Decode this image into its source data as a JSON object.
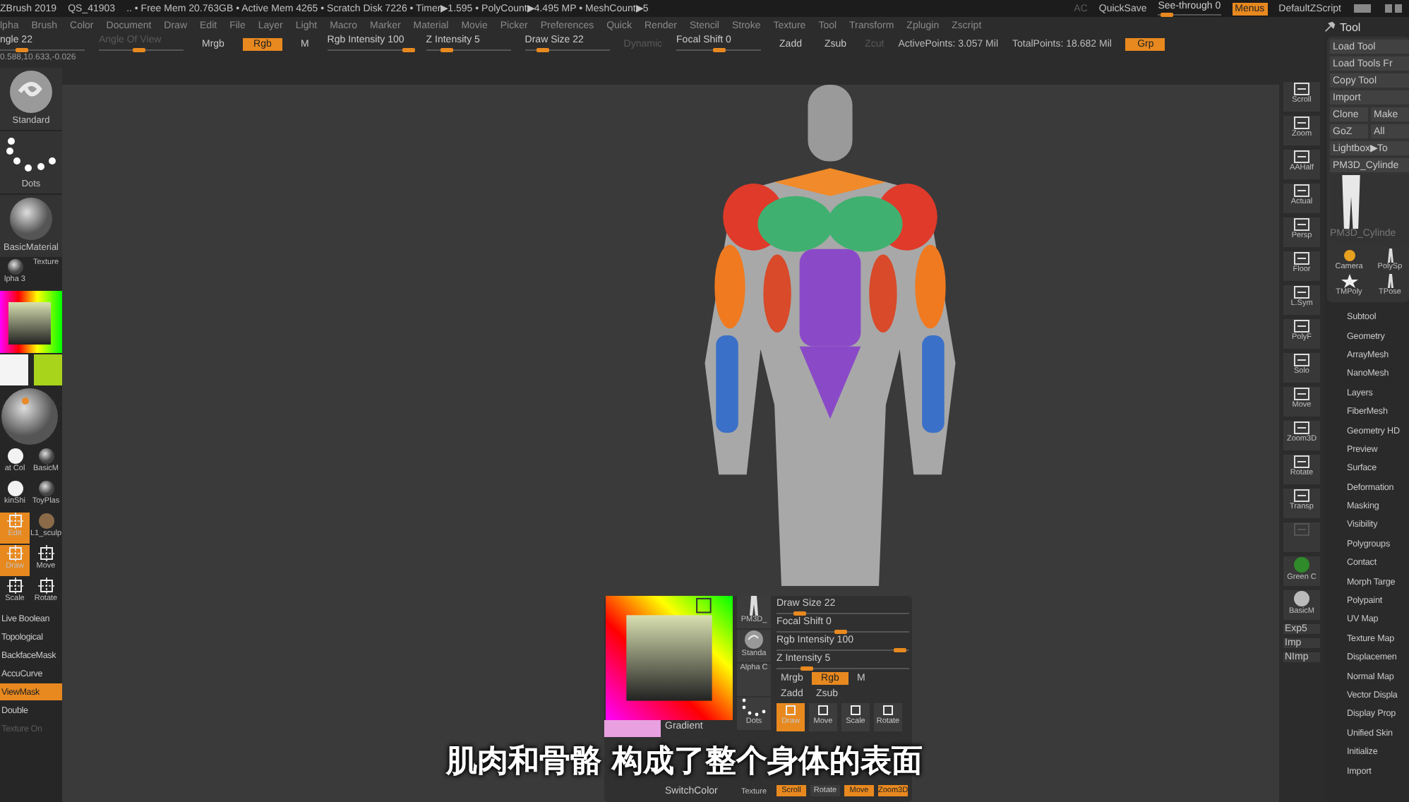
{
  "title_bar": {
    "app": "ZBrush 2019",
    "file": "QS_41903",
    "status": ".. • Free Mem 20.763GB • Active Mem 4265 • Scratch Disk 7226 • Timer▶1.595 • PolyCount▶4.495 MP • MeshCount▶5",
    "controls": [
      {
        "kind": "text",
        "label": "AC",
        "disabled": true
      },
      {
        "kind": "text",
        "label": "QuickSave",
        "disabled": false
      },
      {
        "kind": "slider",
        "label": "See-through 0",
        "level": 0.05
      },
      {
        "kind": "button",
        "label": "Menus",
        "selected": true
      },
      {
        "kind": "text",
        "label": "DefaultZScript",
        "disabled": false
      }
    ]
  },
  "menu": [
    "lpha",
    "Brush",
    "Color",
    "Document",
    "Draw",
    "Edit",
    "File",
    "Layer",
    "Light",
    "Macro",
    "Marker",
    "Material",
    "Movie",
    "Picker",
    "Preferences",
    "Quick",
    "Render",
    "Stencil",
    "Stroke",
    "Texture",
    "Tool",
    "Transform",
    "Zplugin",
    "Zscript"
  ],
  "top_shelf": [
    {
      "kind": "slider",
      "label": "ngle 22",
      "level": 0.2,
      "disabled": false
    },
    {
      "kind": "slider",
      "label": "Angle Of View",
      "level": 0.45,
      "disabled": true
    },
    {
      "kind": "toggle",
      "label": "Mrgb",
      "selected": false
    },
    {
      "kind": "toggle",
      "label": "Rgb",
      "selected": true
    },
    {
      "kind": "toggle",
      "label": "M",
      "selected": false
    },
    {
      "kind": "slider",
      "label": "Rgb Intensity 100",
      "level": 1,
      "disabled": false
    },
    {
      "kind": "slider",
      "label": "Z Intensity 5",
      "level": 0.2,
      "disabled": false
    },
    {
      "kind": "slider",
      "label": "Draw Size 22",
      "level": 0.15,
      "disabled": false
    },
    {
      "kind": "text",
      "label": "Dynamic",
      "disabled": true
    },
    {
      "kind": "slider",
      "label": "Focal Shift 0",
      "level": 0.5,
      "disabled": false
    },
    {
      "kind": "toggle",
      "label": "Zadd",
      "selected": false
    },
    {
      "kind": "toggle",
      "label": "Zsub",
      "selected": false
    },
    {
      "kind": "text",
      "label": "Zcut",
      "disabled": true
    },
    {
      "kind": "text",
      "label": "ActivePoints: 3.057 Mil",
      "disabled": false
    },
    {
      "kind": "text",
      "label": "TotalPoints: 18.682 Mil",
      "disabled": false
    },
    {
      "kind": "toggle",
      "label": "Grp",
      "selected": true
    }
  ],
  "coordinates": "0.588,10.633,-0.026",
  "left_shelf": [
    {
      "kind": "swirl",
      "label": "Standard"
    },
    {
      "kind": "dots",
      "label": "Dots"
    },
    {
      "kind": "sphere",
      "label": "BasicMaterial"
    },
    {
      "kind": "pair",
      "items": [
        {
          "kind": "sphere",
          "label": "lpha 3",
          "selected": false
        },
        {
          "kind": "blank",
          "label": "Texture",
          "selected": false
        }
      ]
    },
    {
      "kind": "picker"
    },
    {
      "kind": "swatches",
      "items": [
        {
          "color": "#f4f4f4"
        },
        {
          "color": "#a8d41c"
        }
      ]
    },
    {
      "kind": "preview"
    },
    {
      "kind": "pair",
      "items": [
        {
          "kind": "white",
          "label": "at Col",
          "selected": false
        },
        {
          "kind": "sphere",
          "label": "BasicM",
          "selected": false
        }
      ]
    },
    {
      "kind": "pair",
      "items": [
        {
          "kind": "white",
          "label": "kinShi",
          "selected": false
        },
        {
          "kind": "sphere",
          "label": "ToyPlas",
          "selected": false
        }
      ]
    },
    {
      "kind": "pair",
      "items": [
        {
          "kind": "tool",
          "label": "Edit",
          "selected": true
        },
        {
          "kind": "bronze",
          "label": "L1_sculp",
          "selected": false
        }
      ]
    },
    {
      "kind": "pair",
      "items": [
        {
          "kind": "tool",
          "label": "Draw",
          "selected": true
        },
        {
          "kind": "tool",
          "label": "Move",
          "selected": false
        }
      ]
    },
    {
      "kind": "pair",
      "items": [
        {
          "kind": "tool",
          "label": "Scale",
          "selected": false
        },
        {
          "kind": "tool",
          "label": "Rotate",
          "selected": false
        }
      ]
    },
    {
      "kind": "button",
      "label": "Live Boolean",
      "selected": false,
      "disabled": false
    },
    {
      "kind": "button",
      "label": "Topological",
      "selected": false,
      "disabled": false
    },
    {
      "kind": "button",
      "label": "BackfaceMask",
      "selected": false,
      "disabled": false
    },
    {
      "kind": "button",
      "label": "AccuCurve",
      "selected": false,
      "disabled": false
    },
    {
      "kind": "button",
      "label": "ViewMask",
      "selected": true,
      "disabled": false
    },
    {
      "kind": "button",
      "label": "Double",
      "selected": false,
      "disabled": false
    },
    {
      "kind": "button",
      "label": "Texture On",
      "selected": false,
      "disabled": true
    }
  ],
  "right_shelf": [
    {
      "kind": "tool",
      "label": "Scroll",
      "disabled": false
    },
    {
      "kind": "tool",
      "label": "Zoom",
      "disabled": false
    },
    {
      "kind": "tool",
      "label": "AAHalf",
      "disabled": false
    },
    {
      "kind": "tool",
      "label": "Actual",
      "disabled": false
    },
    {
      "kind": "tool",
      "label": "Persp",
      "disabled": false
    },
    {
      "kind": "tool",
      "label": "Floor",
      "disabled": false
    },
    {
      "kind": "tool",
      "label": "L.Sym",
      "disabled": false
    },
    {
      "kind": "tool",
      "label": "PolyF",
      "disabled": false
    },
    {
      "kind": "tool",
      "label": "Solo",
      "disabled": false
    },
    {
      "kind": "tool",
      "label": "Move",
      "disabled": false
    },
    {
      "kind": "tool",
      "label": "Zoom3D",
      "disabled": false
    },
    {
      "kind": "tool",
      "label": "Rotate",
      "disabled": false
    },
    {
      "kind": "tool",
      "label": "Transp",
      "disabled": false
    },
    {
      "kind": "tool",
      "disabled": true
    },
    {
      "kind": "material",
      "label": "Green C",
      "color": "#2f8a2a"
    },
    {
      "kind": "material",
      "label": "BasicM",
      "color": "#bbbbbb"
    },
    {
      "kind": "text",
      "label": "Exp5"
    },
    {
      "kind": "text",
      "label": "Imp"
    },
    {
      "kind": "text",
      "label": "NImp"
    }
  ],
  "tool_palette": {
    "title": "Tool",
    "button_rows": [
      [
        "Load Tool"
      ],
      [
        "Load Tools Fr"
      ],
      [
        "Copy Tool"
      ],
      [
        "Import"
      ],
      [
        "Clone",
        "Make"
      ],
      [
        "GoZ",
        "All"
      ],
      [
        "Lightbox▶To"
      ],
      [
        "PM3D_Cylinde"
      ]
    ],
    "current_tool": "PM3D_Cylinde",
    "thumbs": [
      {
        "kind": "camera",
        "label": "Camera"
      },
      {
        "kind": "figure",
        "label": "PolySp"
      },
      {
        "kind": "star",
        "label": "TMPoly"
      },
      {
        "kind": "figure",
        "label": "TPose"
      }
    ],
    "sections": [
      "Subtool",
      "Geometry",
      "ArrayMesh",
      "NanoMesh",
      "Layers",
      "FiberMesh",
      "Geometry HD",
      "Preview",
      "Surface",
      "Deformation",
      "Masking",
      "Visibility",
      "Polygroups",
      "Contact",
      "Morph Targe",
      "Polypaint",
      "UV Map",
      "Texture Map",
      "Displacemen",
      "Normal Map",
      "Vector Displa",
      "Display Prop",
      "Unified Skin",
      "Initialize",
      "Import"
    ]
  },
  "popup": {
    "gradient": "Gradient",
    "switch_color": "SwitchColor",
    "thumbs": [
      {
        "kind": "figure",
        "label": "PM3D_"
      },
      {
        "kind": "swirl",
        "label": "Standa"
      },
      {
        "kind": "blank",
        "label": "Alpha C"
      },
      {
        "kind": "dots",
        "label": "Dots"
      },
      {
        "kind": "blank",
        "label": "Texture"
      }
    ],
    "sliders": [
      {
        "label": "Draw Size 22",
        "level": 0.15
      },
      {
        "label": "Focal Shift 0",
        "level": 0.5
      },
      {
        "label": "Rgb Intensity 100",
        "level": 1
      },
      {
        "label": "Z Intensity 5",
        "level": 0.2
      }
    ],
    "toggles": [
      {
        "label": "Mrgb",
        "selected": false
      },
      {
        "label": "Rgb",
        "selected": true
      },
      {
        "label": "M",
        "selected": false
      }
    ],
    "modes": [
      {
        "label": "Zadd",
        "selected": false
      },
      {
        "label": "Zsub",
        "selected": false
      }
    ],
    "tools": [
      {
        "label": "Draw",
        "selected": true
      },
      {
        "label": "Move",
        "selected": false
      },
      {
        "label": "Scale",
        "selected": false
      },
      {
        "label": "Rotate",
        "selected": false
      }
    ],
    "tools_2": [
      {
        "label": "Scroll",
        "selected": true
      },
      {
        "label": "Rotate",
        "selected": false
      },
      {
        "label": "Move",
        "selected": true
      },
      {
        "label": "Zoom3D",
        "selected": true
      }
    ]
  },
  "subtitle": "肌肉和骨骼 构成了整个身体的表面"
}
